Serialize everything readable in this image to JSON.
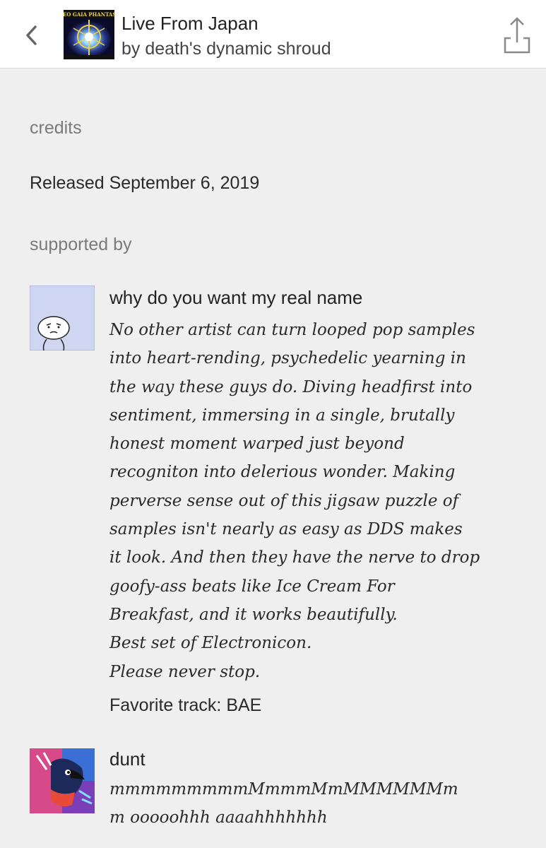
{
  "header": {
    "album_title": "Live From Japan",
    "artist_line": "by death's dynamic shroud",
    "album_art": {
      "caption_line": "NEO GAIA PHANTASY"
    }
  },
  "credits": {
    "heading": "credits",
    "release_text": "Released September 6, 2019"
  },
  "supported_by": {
    "heading": "supported by",
    "supporters": [
      {
        "name": "why do you want my real name",
        "comment": "No other artist can turn looped pop samples\ninto heart-rending, psychedelic yearning in\nthe way these guys do. Diving headfirst into\nsentiment, immersing in a single, brutally\nhonest moment warped just beyond\nrecogniton into delerious wonder. Making\nperverse sense out of this jigsaw puzzle of\nsamples isn't nearly as easy as DDS makes\nit look. And then they have the nerve to drop\ngoofy-ass beats like Ice Cream For\nBreakfast, and it works beautifully.\nBest set of Electronicon.\nPlease never stop.",
        "favorite_track": "Favorite track: BAE"
      },
      {
        "name": "dunt",
        "comment": "mmmmmmmmmMmmmMmMMMMMMm\nm ooooohhh aaaahhhhhhh"
      }
    ]
  },
  "colors": {
    "background": "#efefef",
    "header_bg": "#ffffff",
    "heading_gray": "#7a7a7a",
    "avatar1_bg": "#cfd6f2"
  },
  "icons": {
    "back": "chevron-left-icon",
    "share": "share-icon"
  }
}
